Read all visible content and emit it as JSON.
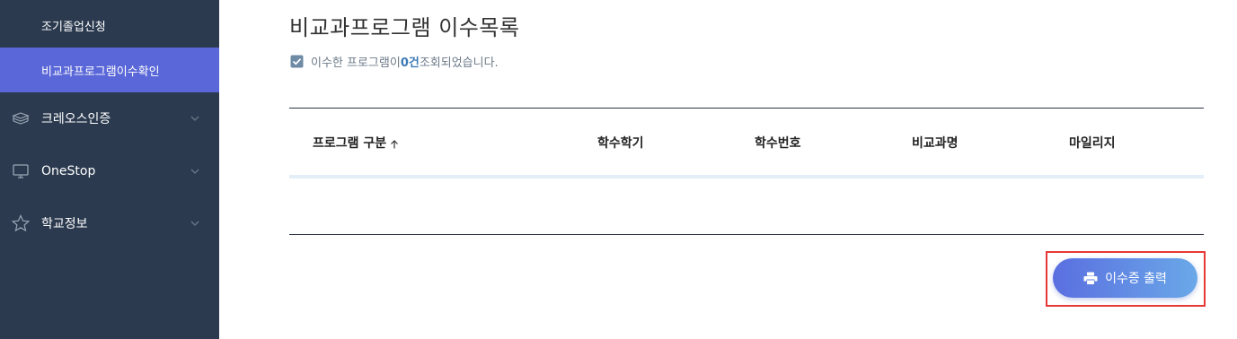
{
  "sidebar": {
    "sub_items": [
      {
        "label": "조기졸업신청"
      },
      {
        "label": "비교과프로그램이수확인",
        "active": true
      }
    ],
    "menu": [
      {
        "label": "크레오스인증",
        "icon": "books-icon"
      },
      {
        "label": "OneStop",
        "icon": "monitor-icon"
      },
      {
        "label": "학교정보",
        "icon": "star-icon"
      }
    ]
  },
  "main": {
    "title": "비교과프로그램 이수목록",
    "info": {
      "prefix": "이수한 프로그램이 ",
      "count": "0건",
      "suffix": " 조회되었습니다."
    },
    "table": {
      "columns": [
        "프로그램 구분",
        "학수학기",
        "학수번호",
        "비교과명",
        "마일리지"
      ],
      "rows": []
    },
    "print_button": {
      "label": "이수증 출력",
      "icon": "printer-icon"
    }
  },
  "colors": {
    "sidebar_bg": "#2b3a4f",
    "active_item": "#5a67d8",
    "button_gradient_start": "#5a6fe0",
    "button_gradient_end": "#6aa8e8",
    "highlight_frame": "#e53935"
  }
}
